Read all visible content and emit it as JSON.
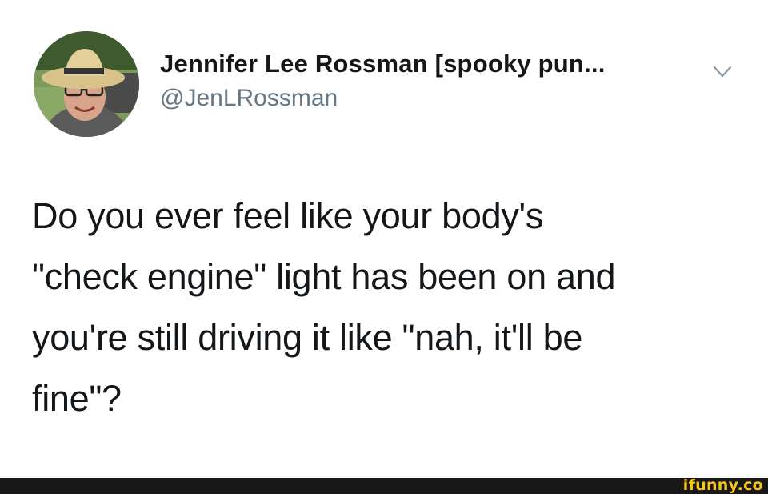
{
  "tweet": {
    "display_name": "Jennifer Lee Rossman [spooky pun...",
    "handle": "@JenLRossman",
    "text": "Do you ever feel like your body's\n\"check engine\" light has been on and\nyou're still driving it like \"nah, it'll be\nfine\"?",
    "menu_icon": "chevron-down-icon",
    "avatar_icon": "profile-photo"
  },
  "footer": {
    "watermark": "ifunny.co",
    "watermark_color": "#f5c518"
  },
  "colors": {
    "text": "#14171a",
    "handle": "#657786",
    "chevron": "#8899a6",
    "footer_bar": "#181818"
  }
}
